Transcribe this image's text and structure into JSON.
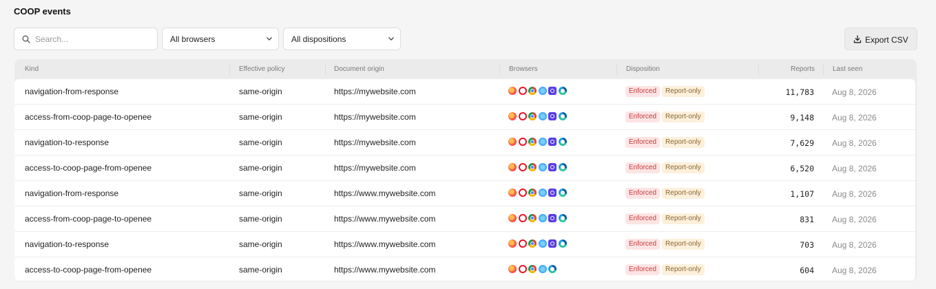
{
  "page": {
    "title": "COOP events"
  },
  "toolbar": {
    "search_placeholder": "Search...",
    "browsers_filter": "All browsers",
    "disposition_filter": "All dispositions",
    "export_label": "Export CSV"
  },
  "table": {
    "columns": {
      "kind": "Kind",
      "policy": "Effective policy",
      "origin": "Document origin",
      "browsers": "Browsers",
      "disposition": "Disposition",
      "reports": "Reports",
      "last_seen": "Last seen"
    },
    "rows": [
      {
        "kind": "navigation-from-response",
        "policy": "same-origin",
        "origin": "https://mywebsite.com",
        "browsers": [
          "firefox-icon",
          "opera-icon",
          "chrome-icon",
          "safari-icon",
          "brave-icon",
          "edge-icon"
        ],
        "disposition": [
          "Enforced",
          "Report-only"
        ],
        "reports": "11,783",
        "last_seen": "Aug 8, 2026"
      },
      {
        "kind": "access-from-coop-page-to-openee",
        "policy": "same-origin",
        "origin": "https://mywebsite.com",
        "browsers": [
          "firefox-icon",
          "opera-icon",
          "chrome-icon",
          "safari-icon",
          "brave-icon",
          "edge-icon"
        ],
        "disposition": [
          "Enforced",
          "Report-only"
        ],
        "reports": "9,148",
        "last_seen": "Aug 8, 2026"
      },
      {
        "kind": "navigation-to-response",
        "policy": "same-origin",
        "origin": "https://mywebsite.com",
        "browsers": [
          "firefox-icon",
          "opera-icon",
          "chrome-icon",
          "safari-icon",
          "brave-icon",
          "edge-icon"
        ],
        "disposition": [
          "Enforced",
          "Report-only"
        ],
        "reports": "7,629",
        "last_seen": "Aug 8, 2026"
      },
      {
        "kind": "access-to-coop-page-from-openee",
        "policy": "same-origin",
        "origin": "https://mywebsite.com",
        "browsers": [
          "firefox-icon",
          "opera-icon",
          "chrome-icon",
          "safari-icon",
          "brave-icon",
          "edge-icon"
        ],
        "disposition": [
          "Enforced",
          "Report-only"
        ],
        "reports": "6,520",
        "last_seen": "Aug 8, 2026"
      },
      {
        "kind": "navigation-from-response",
        "policy": "same-origin",
        "origin": "https://www.mywebsite.com",
        "browsers": [
          "firefox-icon",
          "opera-icon",
          "chrome-icon",
          "safari-icon",
          "brave-icon",
          "edge-icon"
        ],
        "disposition": [
          "Enforced",
          "Report-only"
        ],
        "reports": "1,107",
        "last_seen": "Aug 8, 2026"
      },
      {
        "kind": "access-from-coop-page-to-openee",
        "policy": "same-origin",
        "origin": "https://www.mywebsite.com",
        "browsers": [
          "firefox-icon",
          "opera-icon",
          "chrome-icon",
          "safari-icon",
          "brave-icon",
          "edge-icon"
        ],
        "disposition": [
          "Enforced",
          "Report-only"
        ],
        "reports": "831",
        "last_seen": "Aug 8, 2026"
      },
      {
        "kind": "navigation-to-response",
        "policy": "same-origin",
        "origin": "https://www.mywebsite.com",
        "browsers": [
          "firefox-icon",
          "opera-icon",
          "chrome-icon",
          "safari-icon",
          "brave-icon",
          "edge-icon"
        ],
        "disposition": [
          "Enforced",
          "Report-only"
        ],
        "reports": "703",
        "last_seen": "Aug 8, 2026"
      },
      {
        "kind": "access-to-coop-page-from-openee",
        "policy": "same-origin",
        "origin": "https://www.mywebsite.com",
        "browsers": [
          "firefox-icon",
          "opera-icon",
          "chrome-icon",
          "safari-icon",
          "edge-icon"
        ],
        "disposition": [
          "Enforced",
          "Report-only"
        ],
        "reports": "604",
        "last_seen": "Aug 8, 2026"
      }
    ]
  },
  "colors": {
    "enforced_bg": "#fde4e4",
    "enforced_text": "#c43a3a",
    "report_only_bg": "#fdf0dc",
    "report_only_text": "#8a6530"
  }
}
